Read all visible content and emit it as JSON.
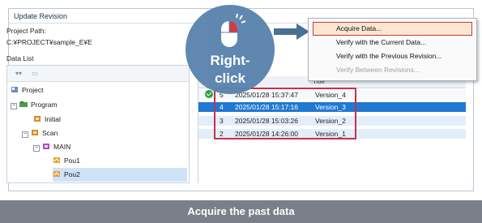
{
  "window": {
    "title": "Update Revision",
    "project_path_label": "Project Path:",
    "project_path_value": "C:¥PROJECT¥sample_E¥E",
    "data_list_label": "Data List"
  },
  "tree": {
    "items": [
      {
        "label": "Project"
      },
      {
        "label": "Program"
      },
      {
        "label": "Initial"
      },
      {
        "label": "Scan"
      },
      {
        "label": "MAIN"
      },
      {
        "label": "Pou1"
      },
      {
        "label": "Pou2"
      }
    ]
  },
  "table": {
    "title_header": "Title",
    "rows": [
      {
        "no": "5",
        "date": "2025/01/28 15:37:47",
        "title": "Version_4"
      },
      {
        "no": "4",
        "date": "2025/01/28 15:17:16",
        "title": "Version_3"
      },
      {
        "no": "3",
        "date": "2025/01/28 15:03:26",
        "title": "Version_2"
      },
      {
        "no": "2",
        "date": "2025/01/28 14:26:00",
        "title": "Version_1"
      }
    ]
  },
  "context_menu": {
    "items": [
      {
        "label": "Acquire Data...",
        "enabled": true
      },
      {
        "label": "Verify with the Current Data...",
        "enabled": true
      },
      {
        "label": "Verify with the Previous Revision...",
        "enabled": true
      },
      {
        "label": "Verify Between Revisions...",
        "enabled": false
      }
    ]
  },
  "callout": {
    "line1": "Right-",
    "line2": "click",
    "icon": "mouse-right-click-icon"
  },
  "caption": "Acquire the past data",
  "colors": {
    "accent": "#1f78d1",
    "highlight_border": "#c5314a",
    "callout_bg": "#5b84ad",
    "caption_bg": "#7a7f8a"
  }
}
